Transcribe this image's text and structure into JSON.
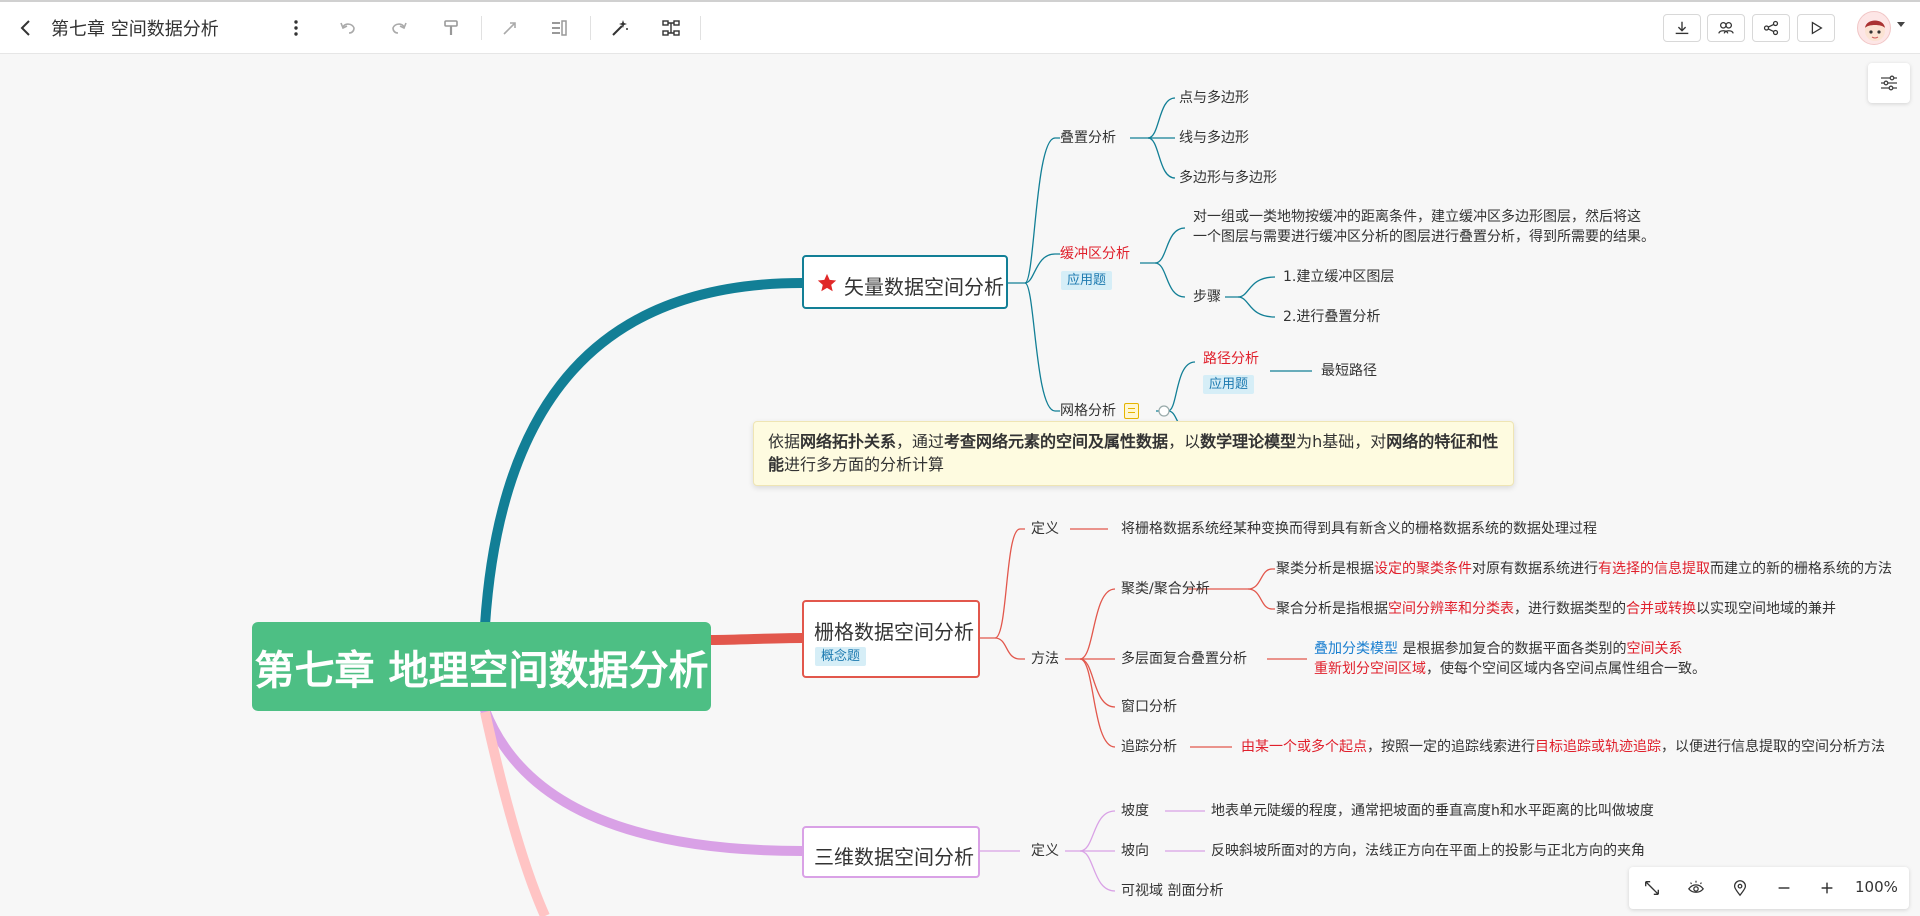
{
  "toolbar": {
    "title": "第七章 空间数据分析",
    "back_icon": "chevron-left-icon",
    "more_icon": "more-vertical-icon",
    "undo_icon": "undo-icon",
    "redo_icon": "redo-icon",
    "format_painter_icon": "format-painter-icon",
    "connector_icon": "connector-icon",
    "summary_icon": "summary-icon",
    "ai_icon": "magic-wand-icon",
    "structure_icon": "structure-icon",
    "right_actions": [
      "download-icon",
      "collaborate-icon",
      "share-icon",
      "play-icon"
    ]
  },
  "mindmap": {
    "root": "第七章 地理空间数据分析",
    "vector": {
      "label": "矢量数据空间分析",
      "overlay": {
        "label": "叠置分析",
        "children": [
          "点与多边形",
          "线与多边形",
          "多边形与多边形"
        ]
      },
      "buffer": {
        "label": "缓冲区分析",
        "tag": "应用题",
        "desc_line1": "对一组或一类地物按缓冲的距离条件，建立缓冲区多边形图层，然后将这",
        "desc_line2": "一个图层与需要进行缓冲区分析的图层进行叠置分析，得到所需要的结果。",
        "steps_label": "步骤",
        "steps": [
          "1.建立缓冲区图层",
          "2.进行叠置分析"
        ]
      },
      "network": {
        "label": "网格分析",
        "path_label": "路径分析",
        "path_tag": "应用题",
        "path_child": "最短路径"
      }
    },
    "tooltip": {
      "p1": "依据",
      "b1": "网络拓扑关系",
      "p2": "，通过",
      "b2": "考查网络元素的空间及属性数据",
      "p3": "，以",
      "b3": "数学理论模型",
      "p4": "为h基础，对",
      "b4": "网络的特征和性能",
      "p5": "进行多方面的分析计算"
    },
    "raster": {
      "label": "栅格数据空间分析",
      "tag": "概念题",
      "definition_label": "定义",
      "definition_text": "将栅格数据系统经某种变换而得到具有新含义的栅格数据系统的数据处理过程",
      "method_label": "方法",
      "cluster": {
        "label": "聚类/聚合分析",
        "c1_a": "聚类分析是根据",
        "c1_b": "设定的聚类条件",
        "c1_c": "对原有数据系统进行",
        "c1_d": "有选择的信息提取",
        "c1_e": "而建立的新的栅格系统的方法",
        "c2_a": "聚合分析是指根据",
        "c2_b": "空间分辨率和分类表",
        "c2_c": "，进行数据类型的",
        "c2_d": "合并或转换",
        "c2_e": "以实现空间地域的兼并"
      },
      "multilayer": {
        "label": "多层面复合叠置分析",
        "l1_a": "叠加分类模型",
        "l1_b": " 是根据参加复合的数据平面各类别的",
        "l1_c": "空间关系",
        "l2_a": "重新划分空间区域",
        "l2_b": "，使每个空间区域内各空间点属性组合一致。"
      },
      "window": "窗口分析",
      "trace": {
        "label": "追踪分析",
        "a": "由某一个或多个起点",
        "b": "，按照一定的追踪线索进行",
        "c": "目标追踪或轨迹追踪",
        "d": "，以便进行信息提取的空间分析方法"
      }
    },
    "three_d": {
      "label": "三维数据空间分析",
      "definition_label": "定义",
      "slope_label": "坡度",
      "slope_text": "地表单元陡缓的程度，通常把坡面的垂直高度h和水平距离的比叫做坡度",
      "aspect_label": "坡向",
      "aspect_text": "反映斜坡所面对的方向，法线正方向在平面上的投影与正北方向的夹角",
      "visibility_label": "可视域 剖面分析"
    },
    "colors": {
      "vector": "#127f96",
      "raster": "#e2574c",
      "three_d": "#d9a1e6",
      "fourth": "#ffc4c4",
      "root": "#4dbf84"
    }
  },
  "zoom": {
    "value": "100%",
    "icons": [
      "fit-screen-icon",
      "eye-icon",
      "locate-icon",
      "zoom-out-icon",
      "zoom-in-icon"
    ]
  }
}
